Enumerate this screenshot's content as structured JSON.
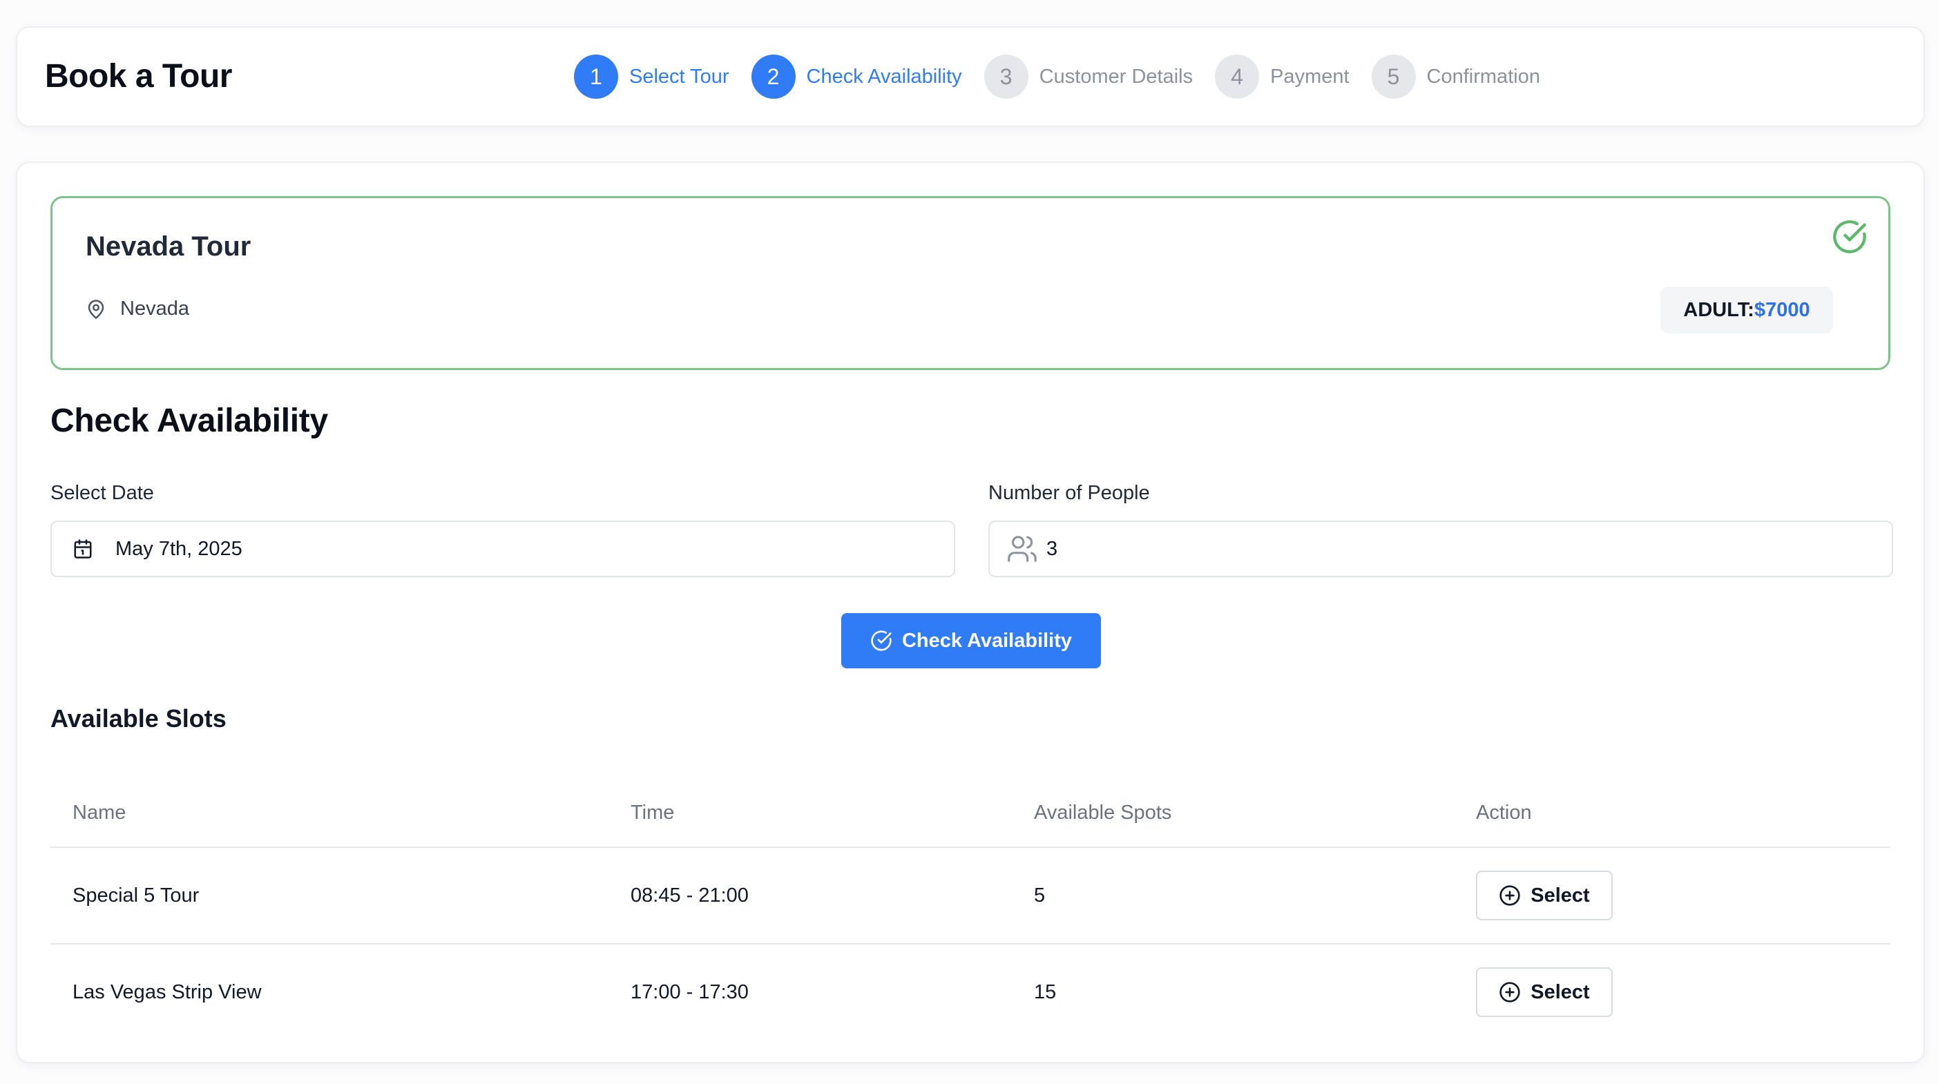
{
  "header": {
    "title": "Book a Tour",
    "steps": [
      {
        "number": "1",
        "label": "Select Tour",
        "state": "active"
      },
      {
        "number": "2",
        "label": "Check Availability",
        "state": "active"
      },
      {
        "number": "3",
        "label": "Customer Details",
        "state": "inactive"
      },
      {
        "number": "4",
        "label": "Payment",
        "state": "inactive"
      },
      {
        "number": "5",
        "label": "Confirmation",
        "state": "inactive"
      }
    ]
  },
  "tour": {
    "name": "Nevada Tour",
    "location": "Nevada",
    "price_label": "ADULT:",
    "price_value": "$7000",
    "selected_icon": "check-circle-icon"
  },
  "availability": {
    "title": "Check Availability",
    "date_label": "Select Date",
    "date_value": "May 7th, 2025",
    "people_label": "Number of People",
    "people_value": "3",
    "button_label": "Check Availability"
  },
  "slots": {
    "title": "Available Slots",
    "columns": [
      "Name",
      "Time",
      "Available Spots",
      "Action"
    ],
    "rows": [
      {
        "name": "Special 5 Tour",
        "time": "08:45 - 21:00",
        "spots": "5",
        "action": "Select"
      },
      {
        "name": "Las Vegas Strip View",
        "time": "17:00 - 17:30",
        "spots": "15",
        "action": "Select"
      }
    ]
  },
  "colors": {
    "accent": "#2f7cf6",
    "selected_border": "#7cc48a",
    "inactive_step": "#e5e7eb",
    "price": "#2f6fe8"
  }
}
